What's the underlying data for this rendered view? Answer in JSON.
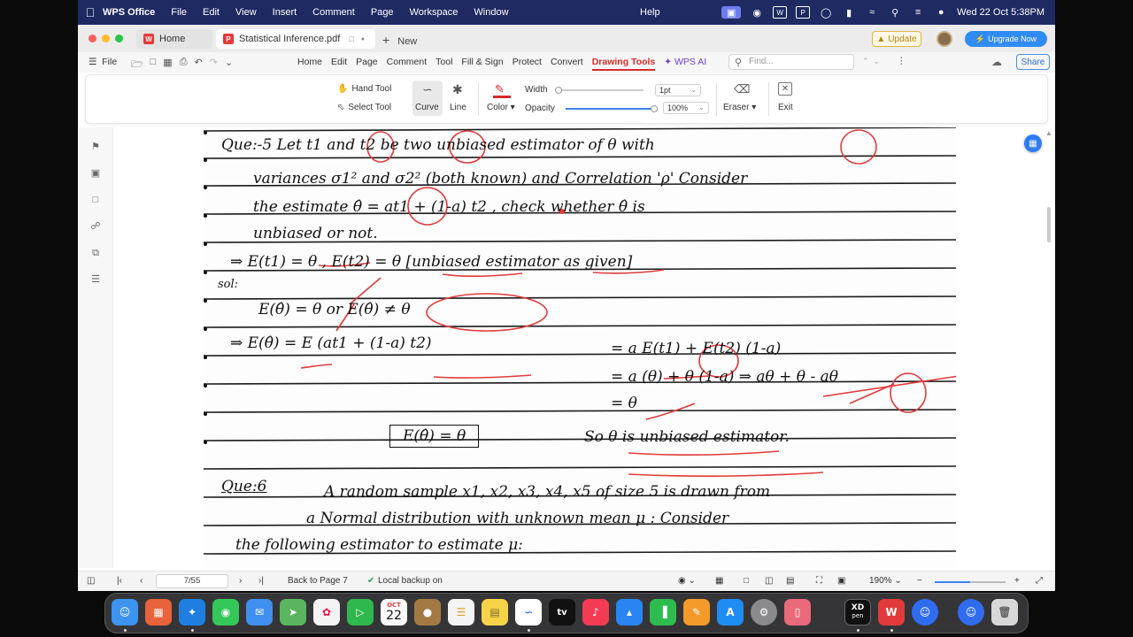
{
  "menubar": {
    "app_name": "WPS Office",
    "items": [
      "File",
      "Edit",
      "View",
      "Insert",
      "Comment",
      "Page",
      "Workspace",
      "Window"
    ],
    "help": "Help",
    "datetime": "Wed 22 Oct  5:38PM"
  },
  "tabs": {
    "home": "Home",
    "document": "Statistical Inference.pdf",
    "new": "New"
  },
  "header_right": {
    "update": "Update",
    "upgrade": "Upgrade Now"
  },
  "menu_row": {
    "file": "File",
    "tabs": [
      "Home",
      "Edit",
      "Page",
      "Comment",
      "Tool",
      "Fill & Sign",
      "Protect",
      "Convert",
      "Drawing Tools"
    ],
    "active_tab": "Drawing Tools",
    "wps_ai": "WPS AI",
    "find_placeholder": "Find...",
    "share": "Share"
  },
  "ribbon": {
    "hand_tool": "Hand Tool",
    "select_tool": "Select Tool",
    "curve": "Curve",
    "line": "Line",
    "color": "Color",
    "width_label": "Width",
    "width_value": "1pt",
    "opacity_label": "Opacity",
    "opacity_value": "100%",
    "opacity_level": 1.0,
    "eraser": "Eraser",
    "exit": "Exit"
  },
  "colors": {
    "accent_red": "#d62b2b",
    "menubar": "#1f2a63",
    "upgrade_blue": "#2f8cf4",
    "ink": "#111111",
    "annotation_red": "#e23a3a"
  },
  "document_text": {
    "q5_line1": "Que:-5  Let  t1 and  t2  be two  unbiased  estimator  of  θ  with",
    "q5_line2": "variances  σ1² and  σ2²  (both known)  and  Correlation 'ρ' Consider",
    "q5_line3": "the  estimate  θ̂  = at1 + (1-a) t2 ,  check  whether  θ̂  is",
    "q5_line4": "unbiased  or  not.",
    "given": "⇒   E(t1) = θ   ,  E(t2) = θ    [unbiased  estimator as given]",
    "sol": "sol:",
    "cond": "E(θ̂) = θ     or     E(θ̂) ≠ θ",
    "step1_left": "⇒  E(θ̂) =  E (at1 + (1-a) t2)",
    "step1_right": "=  a E(t1) +  E(t2) (1-a)",
    "step2": "=  a (θ)  +  θ (1-a)  ⇒  aθ + θ - aθ",
    "step3": "= θ",
    "result_box": "E(θ̂) = θ",
    "result_text": "So  θ  is  unbiased  estimator.",
    "q6_label": "Que:6",
    "q6_line1": "A  random  sample  x1, x2, x3, x4, x5  of  size  5  is  drawn from",
    "q6_line2": "a  Normal  distribution  with  unknown  mean  μ : Consider",
    "q6_line3": "the  following  estimator  to  estimate  μ:"
  },
  "statusbar": {
    "page_indicator": "7/55",
    "back_to_page": "Back to Page 7",
    "backup": "Local backup on",
    "zoom": "190%",
    "zoom_level": 0.5
  },
  "dock": {
    "calendar_month": "OCT",
    "calendar_day": "22",
    "xd_label": "XD",
    "xd_sub": "pen",
    "tv_label": "tv"
  }
}
